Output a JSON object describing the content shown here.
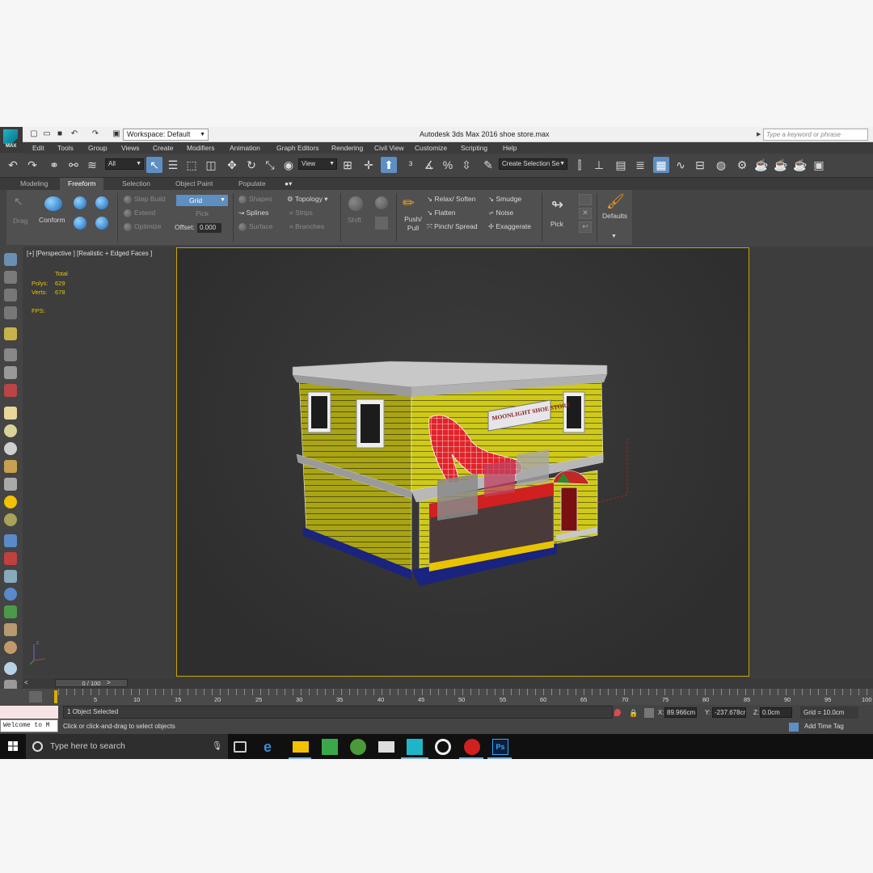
{
  "titlebar": {
    "logo_text": "MAX",
    "workspace": "Workspace: Default",
    "app_title": "Autodesk 3ds Max 2016",
    "document": "shoe store.max",
    "search_placeholder": "Type a keyword or phrase"
  },
  "menu": [
    "Edit",
    "Tools",
    "Group",
    "Views",
    "Create",
    "Modifiers",
    "Animation",
    "Graph Editors",
    "Rendering",
    "Civil View",
    "Customize",
    "Scripting",
    "Help"
  ],
  "toolbar": {
    "selection_filter": "All",
    "ref_coord": "View",
    "named_selection": "Create Selection Se"
  },
  "ribbon": {
    "tabs": [
      "Modeling",
      "Freeform",
      "Selection",
      "Object Paint",
      "Populate"
    ],
    "active_tab": "Freeform",
    "drag": "Drag",
    "conform": "Conform",
    "step_build": "Step Build",
    "extend": "Extend",
    "optimize": "Optimize",
    "grid": "Grid",
    "pick_grid": "Pick",
    "offset_label": "Offset:",
    "offset_value": "0.000",
    "shapes": "Shapes",
    "splines": "Splines",
    "surface": "Surface",
    "topology": "Topology",
    "strips": "Strips",
    "branches": "Branches",
    "shift": "Shift",
    "push_pull": "Push/\nPull",
    "relax": "Relax/ Soften",
    "flatten": "Flatten",
    "pinch": "Pinch/ Spread",
    "smudge": "Smudge",
    "noise": "Noise",
    "exaggerate": "Exaggerate",
    "pick": "Pick",
    "defaults": "Defaults"
  },
  "viewport": {
    "label": "[+] [Perspective ] [Realistic + Edged Faces ]",
    "stats_header": "Total",
    "polys_label": "Polys:",
    "polys": "629",
    "verts_label": "Verts:",
    "verts": "678",
    "fps_label": "FPS:",
    "sign_text": "MOONLIGHT SHOE STORE"
  },
  "timeline": {
    "slider": "0 / 100",
    "ticks": [
      "5",
      "10",
      "15",
      "20",
      "25",
      "30",
      "35",
      "40",
      "45",
      "50",
      "55",
      "60",
      "65",
      "70",
      "75",
      "80",
      "85",
      "90",
      "95",
      "100"
    ]
  },
  "status": {
    "listener": "Welcome to M",
    "selection": "1 Object Selected",
    "prompt": "Click or click-and-drag to select objects",
    "x_label": "X:",
    "x": "89.966cm",
    "y_label": "Y:",
    "y": "-237.678cr",
    "z_label": "Z:",
    "z": "0.0cm",
    "grid": "Grid = 10.0cm",
    "add_time_tag": "Add Time Tag"
  },
  "taskbar": {
    "search_placeholder": "Type here to search",
    "ps_label": "Ps"
  },
  "colors": {
    "selection_blue": "#5e8fc2",
    "viewport_border": "#c9a400",
    "stats_yellow": "#e8c400",
    "building_yellow": "#c9c400"
  }
}
